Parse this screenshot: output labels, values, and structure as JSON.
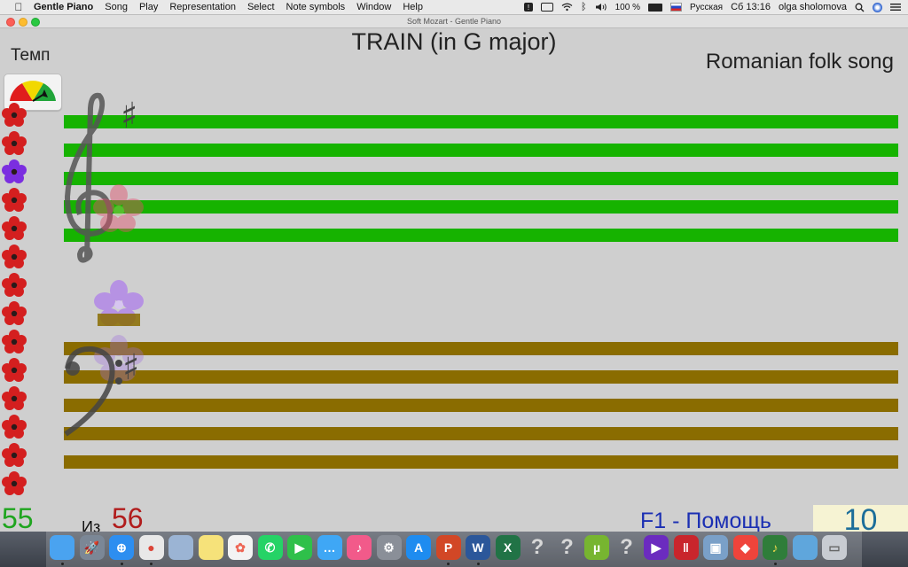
{
  "menubar": {
    "app_name": "Gentle Piano",
    "menus": [
      "Song",
      "Play",
      "Representation",
      "Select",
      "Note symbols",
      "Window",
      "Help"
    ],
    "battery": "100 %",
    "input_language": "Русская",
    "clock": "Сб 13:16",
    "user": "olga sholomova"
  },
  "window": {
    "title": "Soft Mozart - Gentle Piano"
  },
  "content": {
    "song_title": "TRAIN (in G major)",
    "subtitle": "Romanian folk song",
    "tempo_label": "Темп",
    "score": "55",
    "of_label": "Из",
    "total": "56",
    "help": "F1 - Помощь",
    "counter": "10"
  },
  "colors": {
    "treble_staff": "#16b300",
    "bass_staff": "#8a6c00",
    "flower_red": "#d41f1f",
    "flower_purple": "#7b2ee0"
  },
  "flowers": [
    "red",
    "red",
    "purple",
    "red",
    "red",
    "red",
    "red",
    "red",
    "red",
    "red",
    "red",
    "red",
    "red",
    "red"
  ],
  "dock": {
    "icons": [
      "finder-icon",
      "launchpad-icon",
      "safari-icon",
      "chrome-icon",
      "preview-icon",
      "notes-icon",
      "photos-icon",
      "whatsapp-icon",
      "facetime-icon",
      "messages-icon",
      "itunes-icon",
      "system-preferences-icon",
      "app-store-icon",
      "powerpoint-icon",
      "word-icon",
      "excel-icon",
      "unknown-app-icon",
      "unknown-app-icon",
      "utorrent-icon",
      "unknown-app-icon",
      "visual-studio-icon",
      "parallels-icon",
      "image-capture-icon",
      "anydesk-icon",
      "gentle-piano-icon",
      "downloads-folder-icon",
      "trash-icon"
    ],
    "unknown_glyph": "?"
  }
}
